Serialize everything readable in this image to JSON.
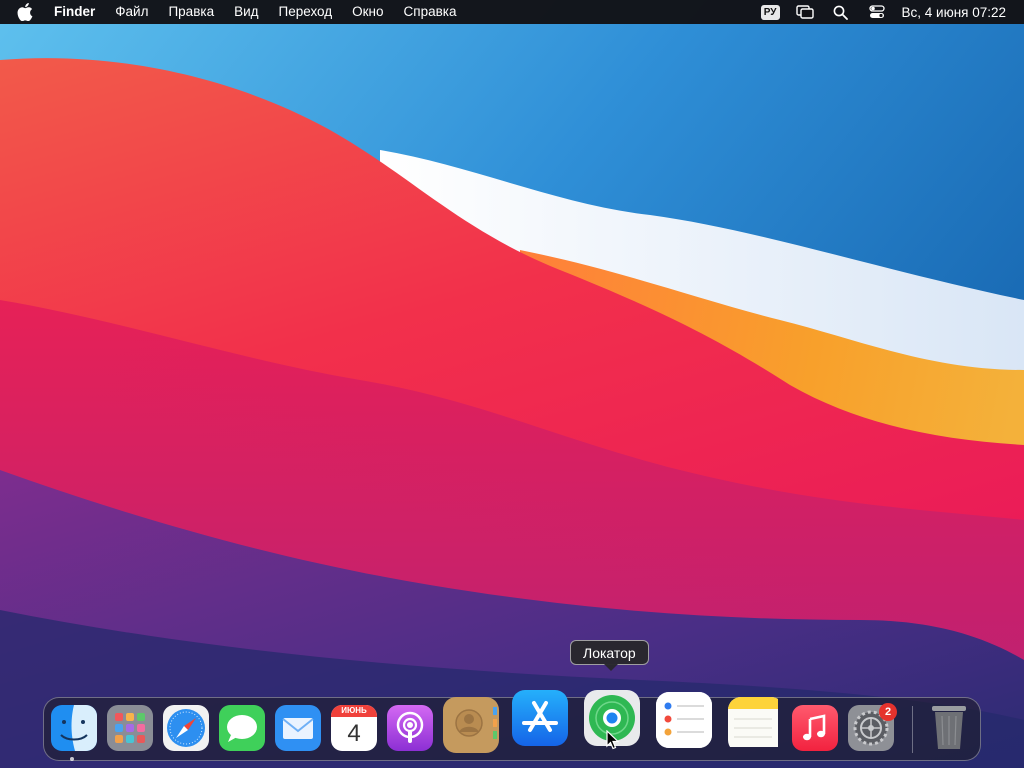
{
  "menubar": {
    "apple_icon": "apple-logo",
    "app_name": "Finder",
    "menus": [
      "Файл",
      "Правка",
      "Вид",
      "Переход",
      "Окно",
      "Справка"
    ],
    "input_source": "РУ",
    "status_icons": [
      "screen-mirroring-icon",
      "search-icon",
      "control-center-icon"
    ],
    "clock": "Вс, 4 июня  07:22"
  },
  "tooltip": {
    "text": "Локатор"
  },
  "dock": {
    "apps": [
      {
        "name": "Finder",
        "icon": "finder-icon",
        "running": true
      },
      {
        "name": "Launchpad",
        "icon": "launchpad-icon"
      },
      {
        "name": "Safari",
        "icon": "safari-icon"
      },
      {
        "name": "Messages",
        "icon": "messages-icon"
      },
      {
        "name": "Mail",
        "icon": "mail-icon"
      },
      {
        "name": "Calendar",
        "icon": "calendar-icon",
        "month": "ИЮНЬ",
        "day": "4"
      },
      {
        "name": "Podcasts",
        "icon": "podcasts-icon"
      },
      {
        "name": "Contacts",
        "icon": "contacts-icon"
      },
      {
        "name": "App Store",
        "icon": "app-store-icon"
      },
      {
        "name": "Локатор",
        "icon": "find-my-icon",
        "hovered": true
      },
      {
        "name": "Reminders",
        "icon": "reminders-icon"
      },
      {
        "name": "Notes",
        "icon": "notes-icon"
      },
      {
        "name": "Music",
        "icon": "music-icon"
      },
      {
        "name": "System Preferences",
        "icon": "system-preferences-icon",
        "badge": "2"
      },
      {
        "name": "Trash",
        "icon": "trash-icon"
      }
    ]
  },
  "colors": {
    "menubar_bg": "#121216",
    "wallpaper_blue": "#1f66b8",
    "wallpaper_red": "#f0334b",
    "wallpaper_orange": "#f5a32b",
    "badge_red": "#e5322d"
  }
}
